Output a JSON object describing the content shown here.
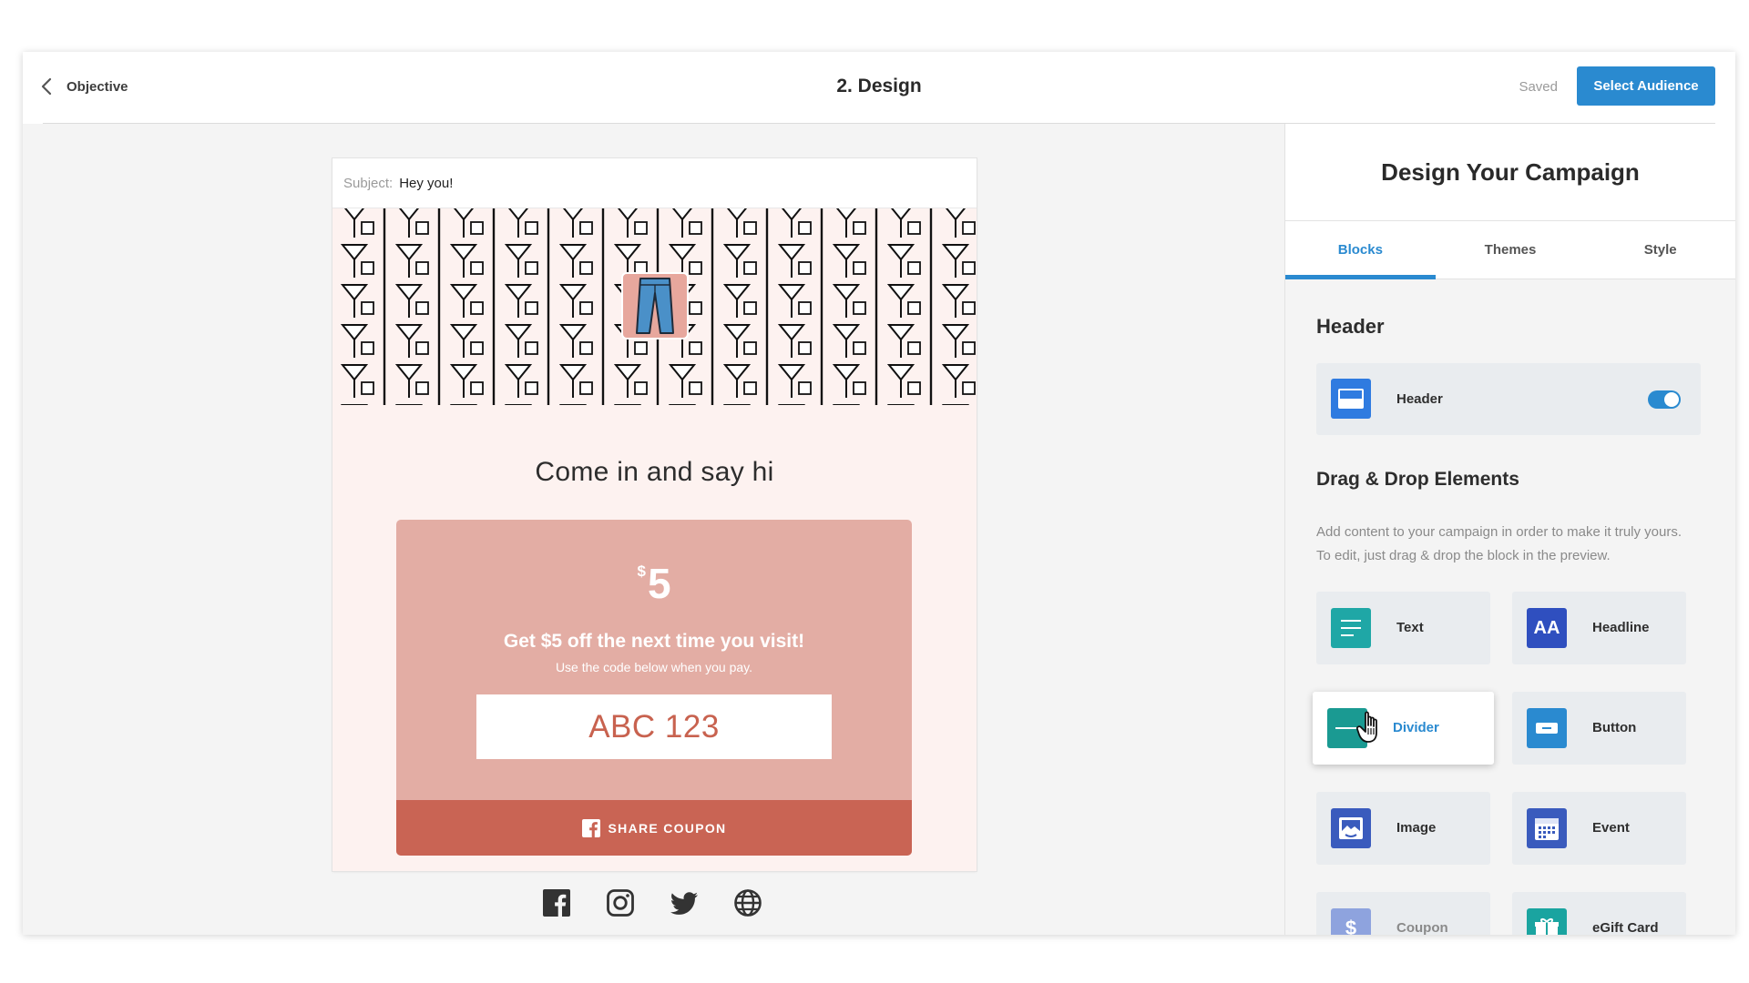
{
  "topbar": {
    "back_label": "Objective",
    "title": "2. Design",
    "saved_label": "Saved",
    "select_audience_label": "Select Audience"
  },
  "email": {
    "subject_label": "Subject:",
    "subject_value": "Hey you!",
    "headline": "Come in and say hi",
    "coupon": {
      "currency": "$",
      "amount": "5",
      "offer": "Get $5 off the next time you visit!",
      "sub": "Use the code below when you pay.",
      "code": "ABC 123",
      "share_label": "SHARE COUPON"
    },
    "socials": [
      "facebook-icon",
      "instagram-icon",
      "twitter-icon",
      "globe-icon"
    ]
  },
  "panel": {
    "title": "Design Your Campaign",
    "tabs": [
      {
        "label": "Blocks",
        "active": true
      },
      {
        "label": "Themes",
        "active": false
      },
      {
        "label": "Style",
        "active": false
      }
    ],
    "header_section_title": "Header",
    "header_card_label": "Header",
    "header_toggle_on": true,
    "drag_title": "Drag & Drop Elements",
    "drag_desc": "Add content to your campaign in order to make it truly yours. To edit, just drag & drop the block in the preview.",
    "elements": [
      {
        "label": "Text",
        "icon": "text-lines-icon",
        "color": "#1fa7a6"
      },
      {
        "label": "Headline",
        "icon": "aa-icon",
        "color": "#2f4fbf"
      },
      {
        "label": "Divider",
        "icon": "divider-icon",
        "color": "#1a9a92"
      },
      {
        "label": "Button",
        "icon": "button-icon",
        "color": "#2a8ad0"
      },
      {
        "label": "Image",
        "icon": "image-icon",
        "color": "#3a5bbd"
      },
      {
        "label": "Event",
        "icon": "calendar-icon",
        "color": "#3a5bbd"
      },
      {
        "label": "Coupon",
        "icon": "coupon-icon",
        "color": "#8ea3de"
      },
      {
        "label": "eGift Card",
        "icon": "gift-icon",
        "color": "#1aa4a0"
      }
    ]
  },
  "colors": {
    "accent": "#2a8ad0",
    "coupon_bg": "#e3ada4",
    "share_bg": "#c96454",
    "code_text": "#c8624f"
  }
}
